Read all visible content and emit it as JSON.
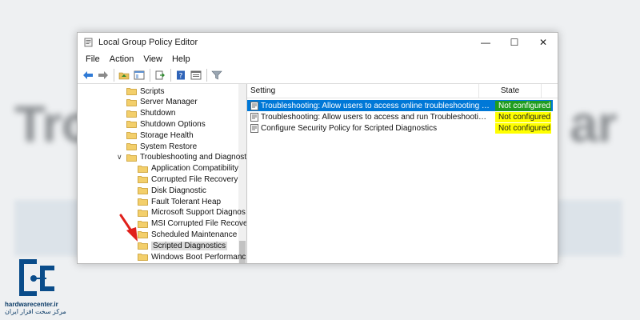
{
  "window": {
    "title": "Local Group Policy Editor",
    "controls": {
      "minimize": "—",
      "maximize": "☐",
      "close": "✕"
    }
  },
  "menu": [
    "File",
    "Action",
    "View",
    "Help"
  ],
  "toolbar": [
    "back-icon",
    "forward-icon",
    "up-folder-icon",
    "show-hide-tree-icon",
    "export-icon",
    "help-icon",
    "properties-icon",
    "filter-icon"
  ],
  "tree": {
    "items": [
      {
        "label": "Scripts",
        "level": 1
      },
      {
        "label": "Server Manager",
        "level": 1
      },
      {
        "label": "Shutdown",
        "level": 1
      },
      {
        "label": "Shutdown Options",
        "level": 1
      },
      {
        "label": "Storage Health",
        "level": 1
      },
      {
        "label": "System Restore",
        "level": 1
      },
      {
        "label": "Troubleshooting and Diagnost",
        "level": 1,
        "expanded": true
      },
      {
        "label": "Application Compatibility",
        "level": 2
      },
      {
        "label": "Corrupted File Recovery",
        "level": 2
      },
      {
        "label": "Disk Diagnostic",
        "level": 2
      },
      {
        "label": "Fault Tolerant Heap",
        "level": 2
      },
      {
        "label": "Microsoft Support Diagnos",
        "level": 2
      },
      {
        "label": "MSI Corrupted File Recove",
        "level": 2
      },
      {
        "label": "Scheduled Maintenance",
        "level": 2
      },
      {
        "label": "Scripted Diagnostics",
        "level": 2,
        "selected": true
      },
      {
        "label": "Windows Boot Performanc",
        "level": 2
      }
    ],
    "expander_glyph": "∨"
  },
  "list": {
    "headers": {
      "setting": "Setting",
      "state": "State"
    },
    "rows": [
      {
        "setting": "Troubleshooting: Allow users to access online troubleshooting co...",
        "state": "Not configured",
        "selected": true
      },
      {
        "setting": "Troubleshooting: Allow users to access and run Troubleshooting ...",
        "state": "Not configured"
      },
      {
        "setting": "Configure Security Policy for Scripted Diagnostics",
        "state": "Not configured"
      }
    ]
  },
  "watermark": {
    "brand": "hardwarecenter.ir",
    "tagline": "مرکز سخت افزار ایران"
  },
  "colors": {
    "selection": "#0078d7",
    "highlight_yellow": "#ffff00",
    "highlight_green": "#1f9c1f",
    "arrow": "#e0201b"
  }
}
